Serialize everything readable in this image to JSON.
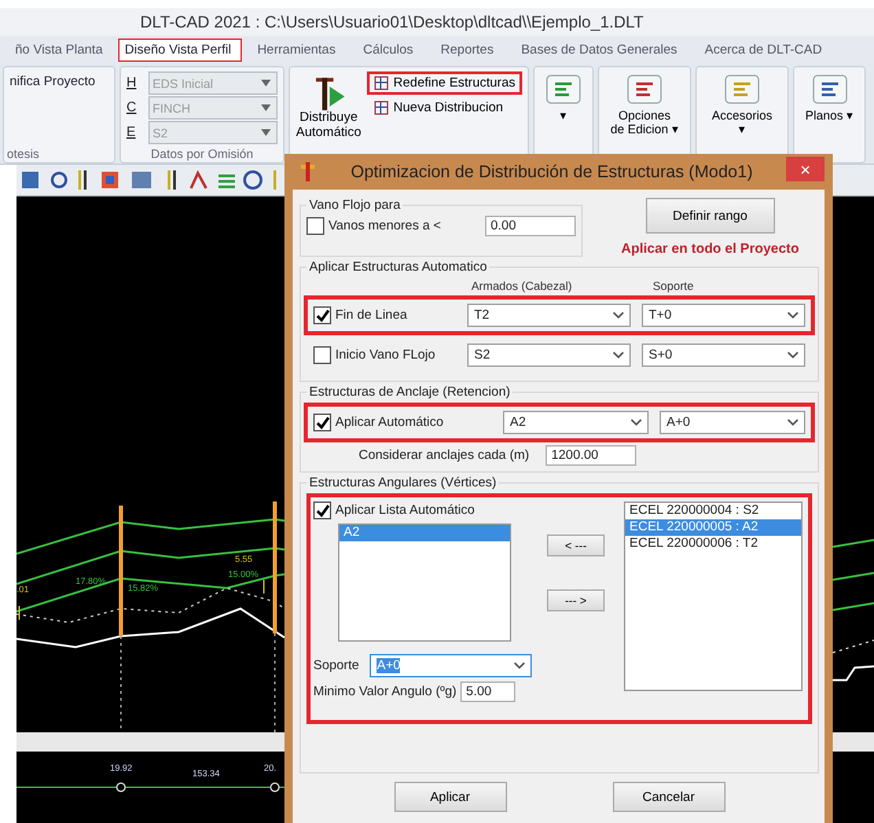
{
  "window": {
    "title": "DLT-CAD 2021 : C:\\Users\\Usuario01\\Desktop\\dltcad\\\\Ejemplo_1.DLT"
  },
  "tabs": [
    {
      "label": "ño Vista Planta",
      "selected": false,
      "highlighted": false
    },
    {
      "label": "Diseño Vista Perfil",
      "selected": true,
      "highlighted": true
    },
    {
      "label": "Herramientas",
      "selected": false,
      "highlighted": false
    },
    {
      "label": "Cálculos",
      "selected": false,
      "highlighted": false
    },
    {
      "label": "Reportes",
      "selected": false,
      "highlighted": false
    },
    {
      "label": "Bases de Datos Generales",
      "selected": false,
      "highlighted": false
    },
    {
      "label": "Acerca de DLT-CAD",
      "selected": false,
      "highlighted": false
    }
  ],
  "ribbon": {
    "project_button": "nifica Proyecto",
    "project_group_label": "otesis",
    "defaults": {
      "label": "Datos por Omisión",
      "fields": [
        {
          "key": "H",
          "value": "EDS Inicial",
          "disabled": true
        },
        {
          "key": "C",
          "value": "FINCH",
          "disabled": true
        },
        {
          "key": "E",
          "value": "S2",
          "disabled": true
        }
      ]
    },
    "distribute_button": "Distribuye Automático",
    "small_buttons": [
      {
        "label": "Redefine Estructuras",
        "highlighted": true
      },
      {
        "label": "Nueva Distribucion",
        "highlighted": false
      }
    ],
    "dropdown_buttons": [
      {
        "label": "▾",
        "kind": "icon"
      },
      {
        "label": "Opciones de Edicion ▾",
        "kind": "edit"
      },
      {
        "label": "Accesorios ▾",
        "kind": "accessories"
      },
      {
        "label": "Planos ▾",
        "kind": "plans"
      }
    ]
  },
  "canvas": {
    "labels": [
      ".01",
      "17.80%",
      "15.82%",
      "5.55",
      "15.00%"
    ],
    "stations": [
      "19.92",
      "153.34",
      "20."
    ]
  },
  "dialog": {
    "title": "Optimizacion de Distribución de Estructuras (Modo1)",
    "close": "×",
    "vano_flojo": {
      "legend": "Vano Flojo para",
      "label": "Vanos menores a <",
      "checked": false,
      "value": "0.00"
    },
    "define_range_button": "Definir rango",
    "apply_all_note": "Aplicar en todo el Proyecto",
    "automatic": {
      "legend": "Aplicar Estructuras Automatico",
      "column_headers": [
        "Armados (Cabezal)",
        "Soporte"
      ],
      "rows": [
        {
          "label": "Fin de Linea",
          "checked": true,
          "armado": "T2",
          "soporte": "T+0",
          "highlighted": true
        },
        {
          "label": "Inicio Vano FLojo",
          "checked": false,
          "armado": "S2",
          "soporte": "S+0",
          "highlighted": false
        }
      ]
    },
    "anchorage": {
      "legend": "Estructuras de Anclaje (Retencion)",
      "highlighted": true,
      "label": "Aplicar Automático",
      "checked": true,
      "armado": "A2",
      "soporte": "A+0",
      "interval_label": "Considerar anclajes cada  (m)",
      "interval_value": "1200.00"
    },
    "angular": {
      "legend": "Estructuras Angulares (Vértices)",
      "highlighted": true,
      "label": "Aplicar Lista Automático",
      "checked": true,
      "left_items": [
        {
          "label": "A2",
          "selected": true
        }
      ],
      "move_buttons": [
        "< ---",
        "--- >"
      ],
      "right_items": [
        {
          "label": "ECEL 220000004 : S2",
          "selected": false
        },
        {
          "label": "ECEL 220000005 : A2",
          "selected": true
        },
        {
          "label": "ECEL 220000006 : T2",
          "selected": false
        }
      ],
      "support_label": "Soporte",
      "support_value": "A+0",
      "min_angle_label": "Minimo Valor Angulo (ºg)",
      "min_angle_value": "5.00"
    },
    "buttons": [
      "Aplicar",
      "Cancelar"
    ]
  }
}
